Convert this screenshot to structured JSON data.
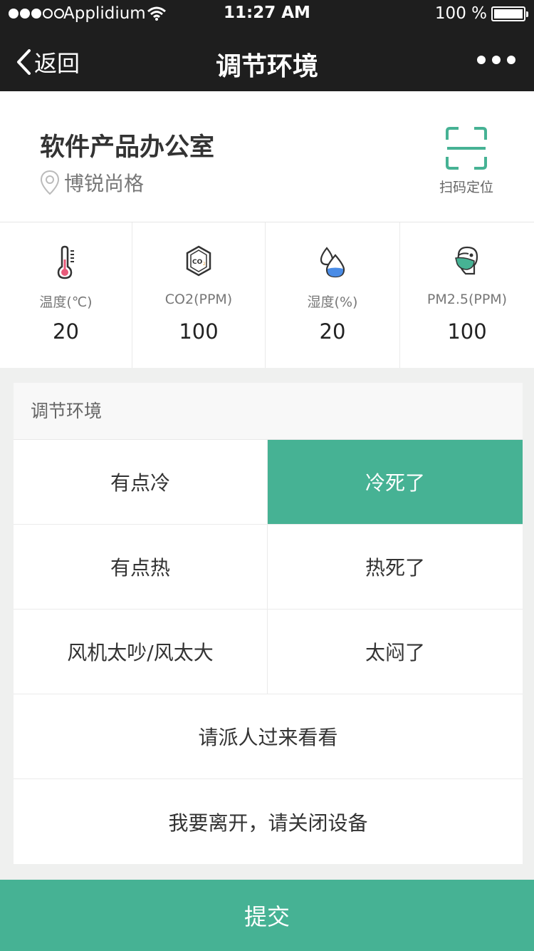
{
  "status_bar": {
    "carrier": "Applidium",
    "time": "11:27 AM",
    "battery": "100 %"
  },
  "nav": {
    "back_label": "返回",
    "title": "调节环境"
  },
  "location": {
    "room": "软件产品办公室",
    "building": "博锐尚格",
    "scan_label": "扫码定位"
  },
  "metrics": [
    {
      "label": "温度(℃)",
      "value": "20",
      "icon": "thermometer-icon"
    },
    {
      "label": "CO2(PPM)",
      "value": "100",
      "icon": "co2-icon"
    },
    {
      "label": "湿度(%)",
      "value": "20",
      "icon": "humidity-drop-icon"
    },
    {
      "label": "PM2.5(PPM)",
      "value": "100",
      "icon": "mask-face-icon"
    }
  ],
  "panel": {
    "title": "调节环境",
    "options": {
      "a_cold": "有点冷",
      "freezing": "冷死了",
      "a_hot": "有点热",
      "boiling": "热死了",
      "fan_noisy": "风机太吵/风太大",
      "stuffy": "太闷了",
      "send_person": "请派人过来看看",
      "leave_off": "我要离开，请关闭设备"
    },
    "selected": "冷死了"
  },
  "submit_label": "提交",
  "colors": {
    "accent": "#46b294",
    "header": "#1e1e1e"
  }
}
